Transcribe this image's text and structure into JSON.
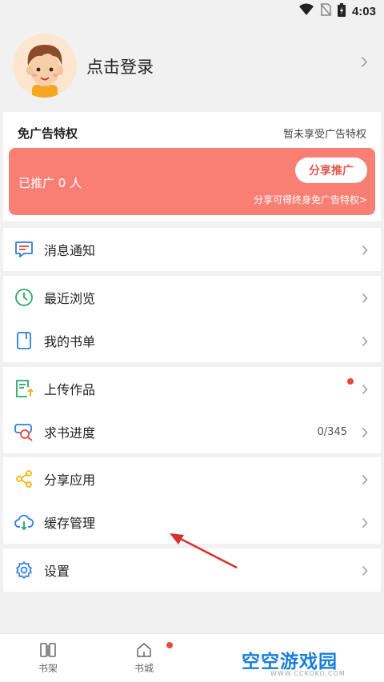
{
  "status_bar": {
    "time": "4:03"
  },
  "profile": {
    "login_label": "点击登录"
  },
  "ad_free": {
    "title": "免广告特权",
    "status": "暂未享受广告特权",
    "promoted_count": "已推广 0 人",
    "share_button": "分享推广",
    "share_hint": "分享可得终身免广告特权>"
  },
  "menu": {
    "messages": "消息通知",
    "recent": "最近浏览",
    "booklist": "我的书单",
    "upload": "上传作品",
    "request": "求书进度",
    "request_value": "0/345",
    "share_app": "分享应用",
    "cache": "缓存管理",
    "settings": "设置"
  },
  "tabs": {
    "shelf": "书架",
    "store": "书城"
  },
  "watermark": {
    "text": "空空游戏园",
    "sub": "WWW.CCKOKO.COM"
  },
  "colors": {
    "promo": "#f97f75",
    "accent_blue": "#1a7fd9",
    "red_dot": "#e84a3f",
    "arrow": "#d9302f"
  }
}
